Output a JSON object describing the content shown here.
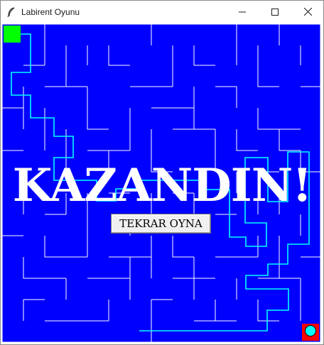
{
  "window": {
    "title": "Labirent Oyunu",
    "controls": [
      "minimize",
      "maximize",
      "close"
    ]
  },
  "game": {
    "win_message": "KAZANDIN!",
    "replay_button": "TEKRAR OYNA",
    "colors": {
      "background": "#0000ff",
      "walls": "#ffffff",
      "path": "#00ffff",
      "start": "#00ff00",
      "goal": "#ff0000",
      "player": "#00ffff"
    }
  }
}
